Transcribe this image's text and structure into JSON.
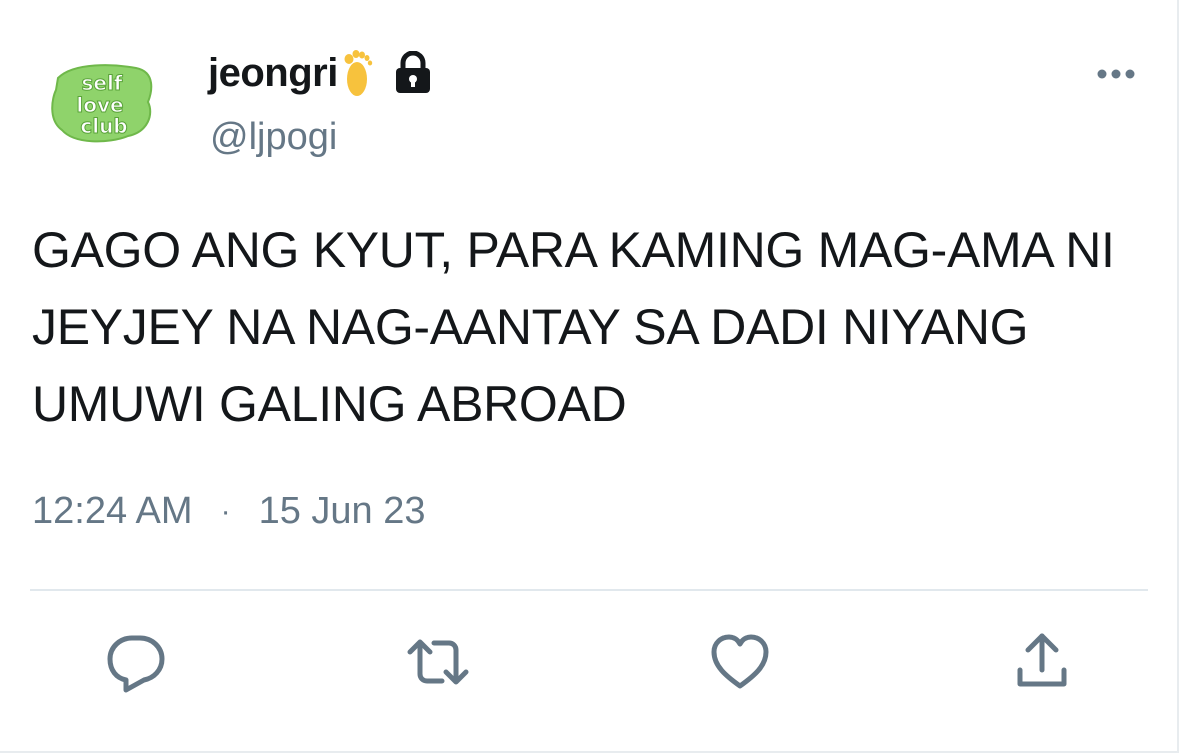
{
  "user": {
    "display_name": "jeongri",
    "handle": "@ljpogi",
    "avatar_text": [
      "self",
      "love",
      "club"
    ],
    "emoji": "foot-emoji",
    "protected_icon": "lock-icon"
  },
  "tweet": {
    "text": "GAGO ANG KYUT, PARA KAMING MAG-AMA NI JEYJEY NA NAG-AANTAY SA DADI NIYANG UMUWI GALING ABROAD",
    "time": "12:24 AM",
    "separator": "·",
    "date": "15 Jun 23"
  },
  "actions": {
    "reply_icon": "reply-icon",
    "retweet_icon": "retweet-icon",
    "like_icon": "heart-icon",
    "share_icon": "share-icon",
    "more_icon": "more-icon"
  },
  "colors": {
    "text_primary": "#14171a",
    "text_secondary": "#657786",
    "avatar_green": "#8fd36b",
    "icon_gray": "#657786"
  }
}
